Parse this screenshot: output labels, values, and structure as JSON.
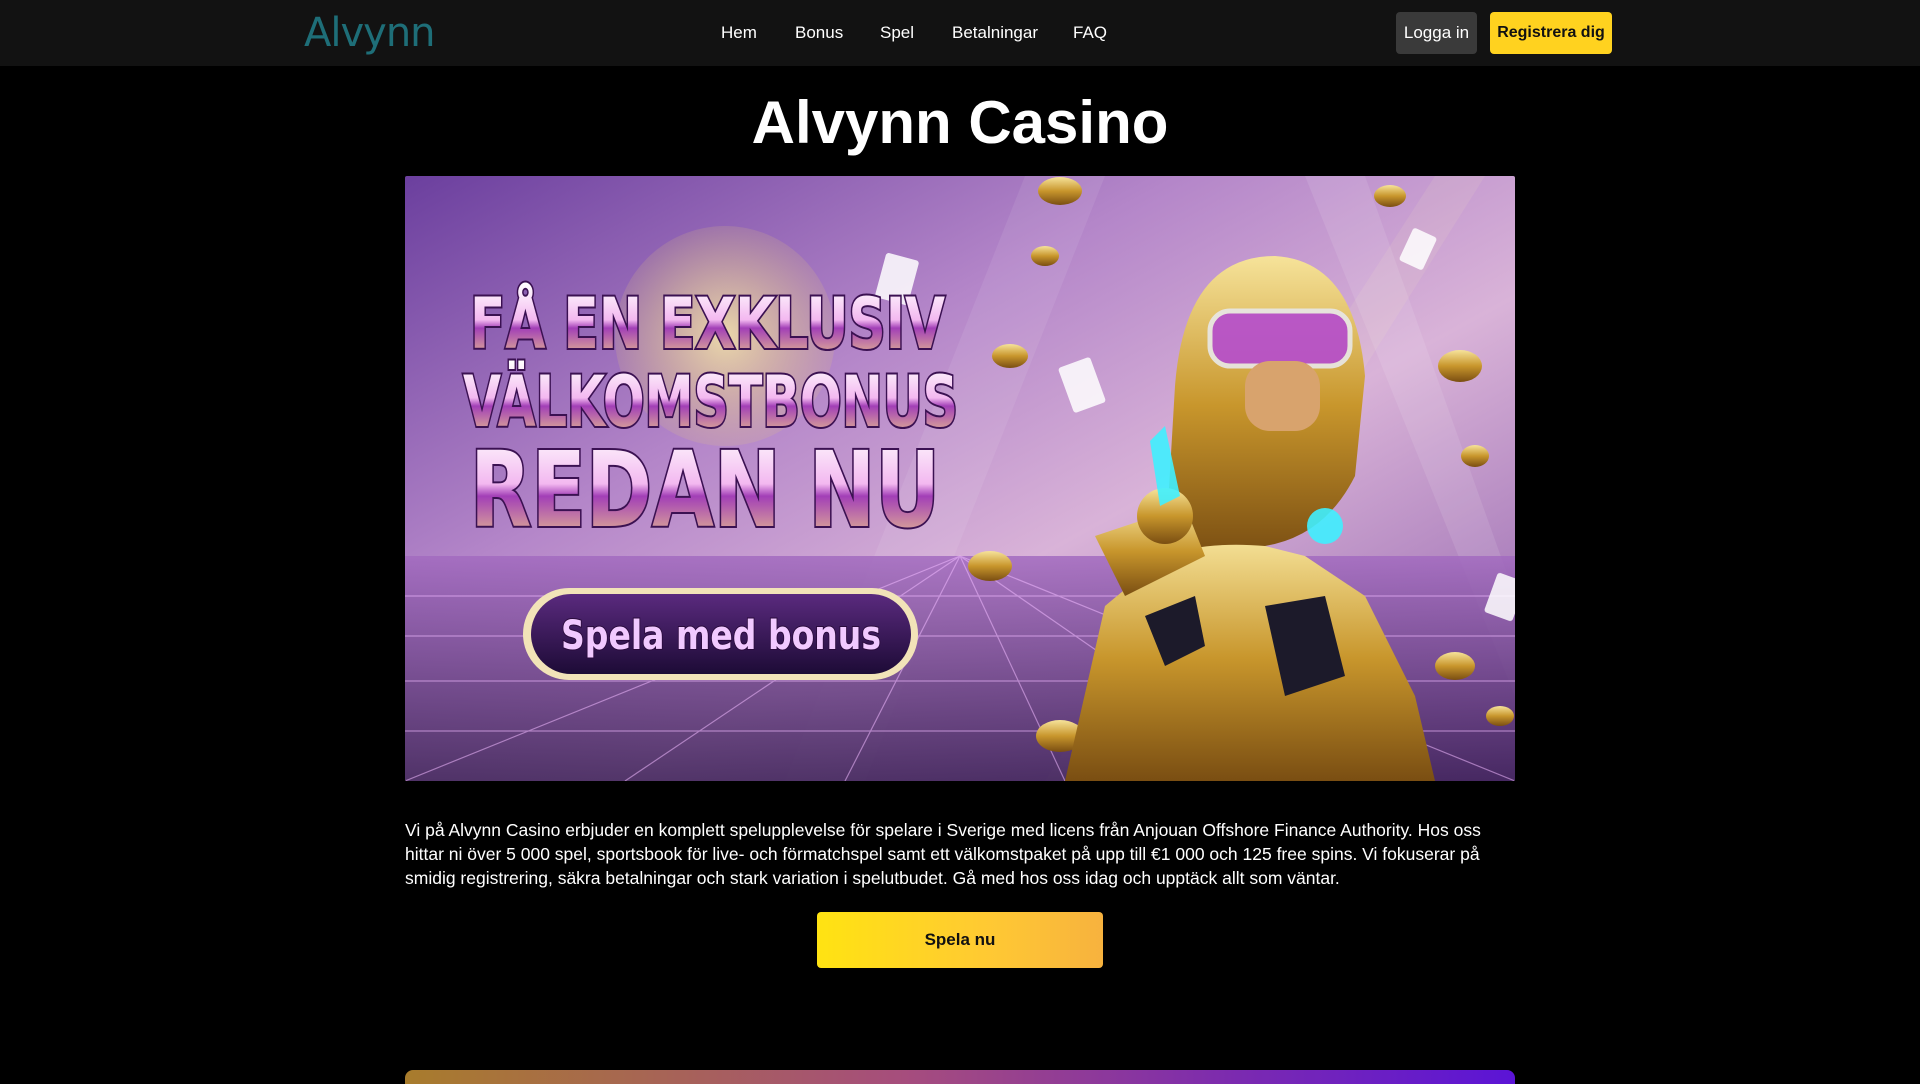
{
  "header": {
    "logo_text": "Alvynn",
    "nav": [
      {
        "label": "Hem"
      },
      {
        "label": "Bonus"
      },
      {
        "label": "Spel"
      },
      {
        "label": "Betalningar"
      },
      {
        "label": "FAQ"
      }
    ],
    "login_label": "Logga in",
    "register_label": "Registrera dig"
  },
  "main": {
    "title": "Alvynn Casino",
    "banner": {
      "headline_lines": [
        "FÅ EN EXKLUSIV",
        "VÄLKOMSTBONUS",
        "REDAN NU"
      ],
      "cta_label": "Spela med bonus"
    },
    "intro_text": "Vi på Alvynn Casino erbjuder en komplett spelupplevelse för spelare i Sverige med licens från Anjouan Offshore Finance Authority. Hos oss hittar ni över 5 000 spel, sportsbook för live- och förmatchspel samt ett välkomstpaket på upp till €1 000 och 125 free spins. Vi fokuserar på smidig registrering, säkra betalningar och stark variation i spelutbudet. Gå med hos oss idag och upptäck allt som väntar.",
    "play_button_label": "Spela nu"
  },
  "colors": {
    "header_bg": "#121212",
    "page_bg": "#000000",
    "accent_yellow": "#ffd21f",
    "logo": "#1e6e78",
    "login_bg": "#3a3a3a"
  }
}
